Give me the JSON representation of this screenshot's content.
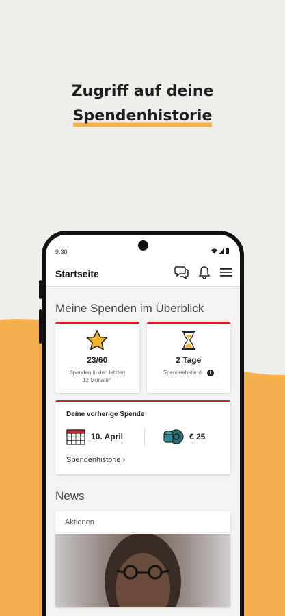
{
  "headline": {
    "line1": "Zugriff auf deine",
    "line2": "Spendenhistorie"
  },
  "colors": {
    "background": "#efeeeb",
    "accent_orange": "#f5b04e",
    "brand_red": "#d3222a"
  },
  "phone": {
    "status_time": "9:30",
    "status_icons": [
      "wifi-icon",
      "signal-icon",
      "battery-icon"
    ],
    "appbar": {
      "title": "Startseite",
      "icons": [
        "chat-icon",
        "bell-icon",
        "menu-icon"
      ]
    },
    "overview": {
      "title": "Meine Spenden im Überblick",
      "cards": [
        {
          "icon": "star-icon",
          "value": "23/60",
          "label": "Spenden in den letzten 12 Monaten"
        },
        {
          "icon": "hourglass-icon",
          "value": "2 Tage",
          "label": "Spendeabstand"
        }
      ]
    },
    "previous_donation": {
      "title": "Deine vorherige Spende",
      "date": "10. April",
      "amount": "€ 25",
      "link": "Spendenhistorie ›"
    },
    "news": {
      "title": "News",
      "tag": "Aktionen"
    }
  }
}
